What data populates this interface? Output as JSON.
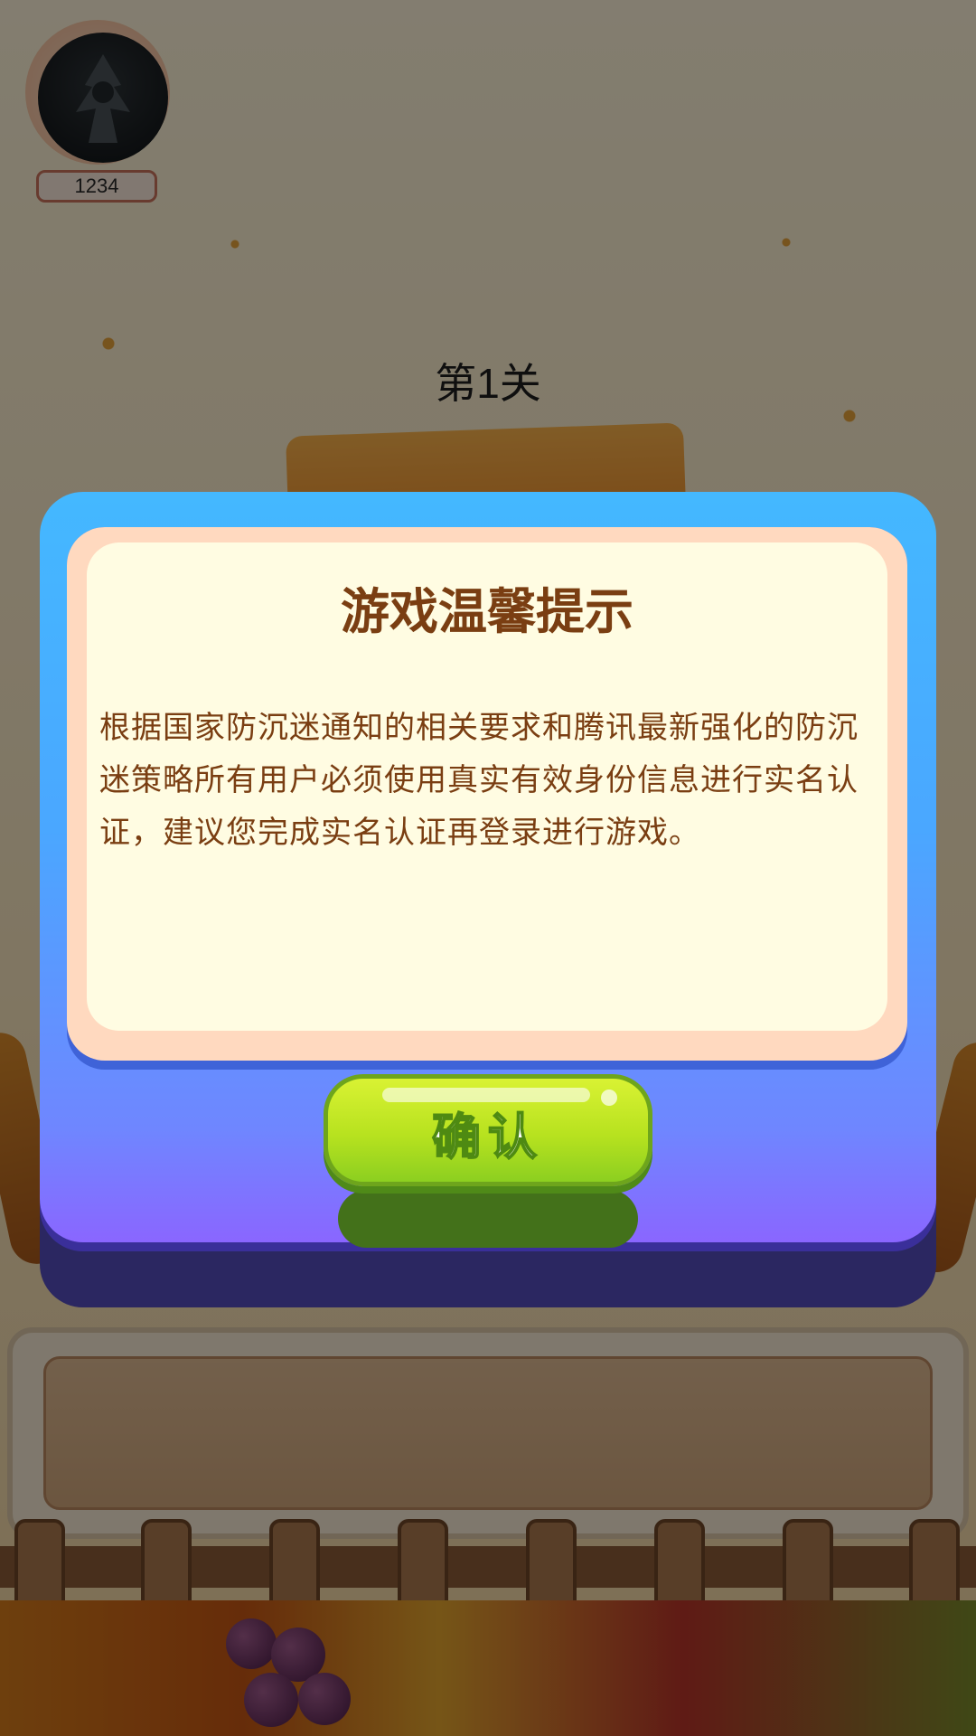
{
  "player": {
    "score": "1234",
    "avatar_icon": "silhouette-avatar-icon"
  },
  "level": {
    "title": "第1关"
  },
  "dialog": {
    "title": "游戏温馨提示",
    "body": "根据国家防沉迷通知的相关要求和腾讯最新强化的防沉迷策略所有用户必须使用真实有效身份信息进行实名认证，建议您完成实名认证再登录进行游戏。",
    "confirm_label": "确认"
  },
  "colors": {
    "dialog_blue": "#44b8ff",
    "dialog_purple": "#8a66ff",
    "paper": "#fffce2",
    "text_brown": "#7a3e12",
    "button_green": "#b7e21f"
  }
}
